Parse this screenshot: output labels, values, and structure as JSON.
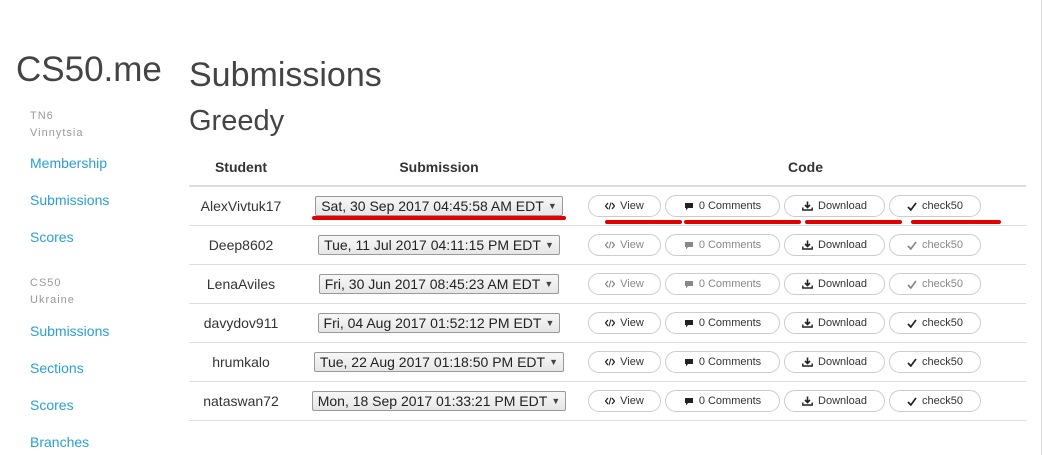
{
  "brand": "CS50.me",
  "sidebar": {
    "groups": [
      {
        "title": "TN6",
        "subtitle": "Vinnytsia",
        "links": [
          "Membership",
          "Submissions",
          "Scores"
        ]
      },
      {
        "title": "CS50",
        "subtitle": "Ukraine",
        "links": [
          "Submissions",
          "Sections",
          "Scores",
          "Branches"
        ]
      }
    ]
  },
  "main": {
    "title": "Submissions",
    "pset": "Greedy",
    "columns": {
      "student": "Student",
      "submission": "Submission",
      "code": "Code"
    },
    "buttons": {
      "view": "View",
      "comments": "0 Comments",
      "download": "Download",
      "check50": "check50"
    },
    "rows": [
      {
        "student": "AlexVivtuk17",
        "submission": "Sat, 30 Sep 2017 04:45:58 AM EDT",
        "view_enabled": true,
        "comments_enabled": true,
        "check50_enabled": true
      },
      {
        "student": "Deep8602",
        "submission": "Tue, 11 Jul 2017 04:11:15 PM EDT",
        "view_enabled": false,
        "comments_enabled": false,
        "check50_enabled": false
      },
      {
        "student": "LenaAviles",
        "submission": "Fri, 30 Jun 2017 08:45:23 AM EDT",
        "view_enabled": false,
        "comments_enabled": false,
        "check50_enabled": false
      },
      {
        "student": "davydov911",
        "submission": "Fri, 04 Aug 2017 01:52:12 PM EDT",
        "view_enabled": true,
        "comments_enabled": true,
        "check50_enabled": true
      },
      {
        "student": "hrumkalo",
        "submission": "Tue, 22 Aug 2017 01:18:50 PM EDT",
        "view_enabled": true,
        "comments_enabled": true,
        "check50_enabled": true
      },
      {
        "student": "nataswan72",
        "submission": "Mon, 18 Sep 2017 01:33:21 PM EDT",
        "view_enabled": true,
        "comments_enabled": true,
        "check50_enabled": true
      }
    ]
  },
  "colors": {
    "link": "#2a9fd6",
    "highlight": "#e00000",
    "text": "#333333"
  },
  "icons": {
    "view": "code-icon",
    "comments": "comment-icon",
    "download": "download-icon",
    "check50": "check-icon",
    "select": "dropdown-caret-icon"
  }
}
